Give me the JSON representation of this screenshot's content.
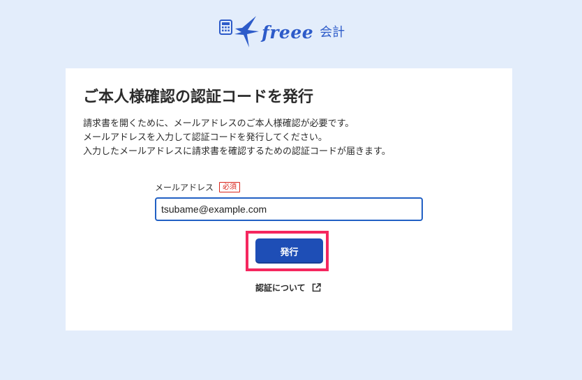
{
  "brand": {
    "name": "freee",
    "product": "会計",
    "logo_icon": "calculator-swallow-logo-icon",
    "color": "#2d5bc9"
  },
  "page": {
    "title": "ご本人様確認の認証コードを発行",
    "description": [
      "請求書を開くために、メールアドレスのご本人様確認が必要です。",
      "メールアドレスを入力して認証コードを発行してください。",
      "入力したメールアドレスに請求書を確認するための認証コードが届きます。"
    ]
  },
  "form": {
    "email_label": "メールアドレス",
    "required_badge": "必須",
    "email_value": "tsubame@example.com",
    "submit_label": "発行"
  },
  "help_link": {
    "label": "認証について",
    "icon": "external-link-icon"
  },
  "colors": {
    "background": "#e3edfb",
    "primary_button": "#1e4eb6",
    "highlight": "#f5275f",
    "required": "#d9261c"
  }
}
